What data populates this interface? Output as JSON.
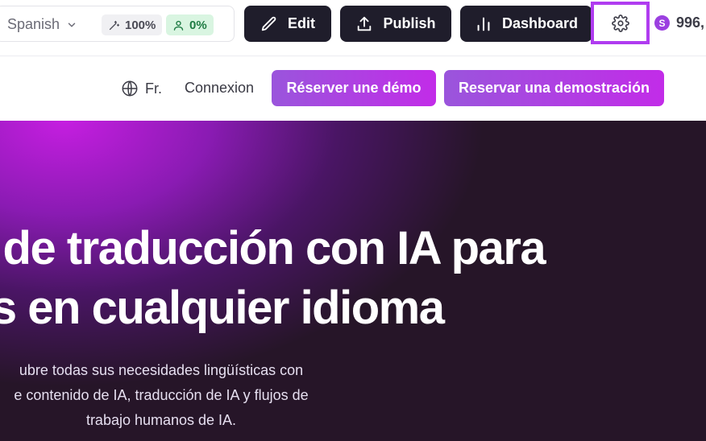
{
  "toolbar": {
    "language": "Spanish",
    "ai_percent": "100%",
    "human_percent": "0%",
    "edit_label": "Edit",
    "publish_label": "Publish",
    "dashboard_label": "Dashboard",
    "credits": "996,",
    "credit_symbol": "S",
    "highlight_color": "#b03cf0"
  },
  "nav": {
    "lang_switch": "Fr.",
    "login": "Connexion",
    "cta_fr": "Réserver une démo",
    "cta_es": "Reservar una demostración"
  },
  "hero": {
    "title_line1": "n de traducción con IA para",
    "title_line2": "os en cualquier idioma",
    "sub_line1": "ubre todas sus necesidades lingüísticas con",
    "sub_line2": "e contenido de IA, traducción de IA y flujos de",
    "sub_line3": "trabajo humanos de IA."
  },
  "icons": {
    "language_dropdown": "chevron-down-icon",
    "ai": "magic-wand-icon",
    "human": "user-icon",
    "edit": "pencil-icon",
    "publish": "upload-icon",
    "dashboard": "bar-chart-icon",
    "settings": "gear-icon",
    "lang_switch": "globe-icon"
  }
}
